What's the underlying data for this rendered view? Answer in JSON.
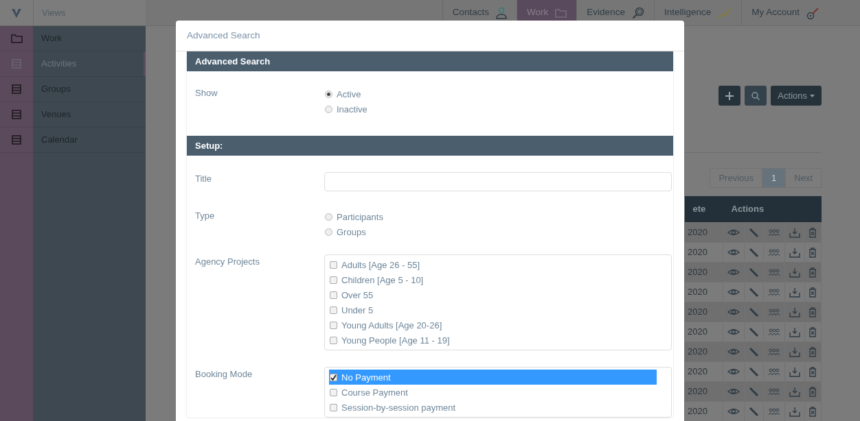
{
  "top_nav": {
    "section": "Views",
    "items": [
      {
        "label": "Contacts",
        "selected": false
      },
      {
        "label": "Work",
        "selected": true
      },
      {
        "label": "Evidence",
        "selected": false
      },
      {
        "label": "Intelligence",
        "selected": false
      },
      {
        "label": "My Account",
        "selected": false
      }
    ]
  },
  "sidebar": {
    "items": [
      {
        "label": "Work",
        "selected": false
      },
      {
        "label": "Activities",
        "selected": true
      },
      {
        "label": "Groups",
        "selected": false
      },
      {
        "label": "Venues",
        "selected": false
      },
      {
        "label": "Calendar",
        "selected": false
      }
    ]
  },
  "toolbar": {
    "actions_label": "Actions"
  },
  "pagination": {
    "previous": "Previous",
    "pages": [
      {
        "label": "1",
        "selected": true
      }
    ],
    "next": "Next"
  },
  "table": {
    "columns": [
      "ete",
      "Actions"
    ],
    "rows": [
      {
        "date": "2020"
      },
      {
        "date": "2020"
      },
      {
        "date": "2020"
      },
      {
        "date": "2020"
      },
      {
        "date": "2020"
      },
      {
        "date": "2020"
      },
      {
        "date": "2020"
      },
      {
        "date": "2020"
      },
      {
        "date": "2020"
      },
      {
        "date": "2020"
      }
    ]
  },
  "modal": {
    "title": "Advanced Search",
    "sections": [
      {
        "heading": "Advanced Search",
        "fields": [
          {
            "label": "Show",
            "kind": "radio",
            "options": [
              {
                "label": "Active",
                "selected": true
              },
              {
                "label": "Inactive",
                "selected": false
              }
            ]
          }
        ]
      },
      {
        "heading": "Setup:",
        "fields": [
          {
            "label": "Title",
            "kind": "text"
          },
          {
            "label": "Type",
            "kind": "radio",
            "options": [
              {
                "label": "Participants",
                "selected": false
              },
              {
                "label": "Groups",
                "selected": false
              }
            ]
          },
          {
            "label": "Agency Projects",
            "kind": "checklist",
            "options": [
              {
                "label": "Adults [Age 26 - 55]",
                "checked": false,
                "selected": false
              },
              {
                "label": "Children [Age 5 - 10]",
                "checked": false,
                "selected": false
              },
              {
                "label": "Over 55",
                "checked": false,
                "selected": false
              },
              {
                "label": "Under 5",
                "checked": false,
                "selected": false
              },
              {
                "label": "Young Adults [Age 20-26]",
                "checked": false,
                "selected": false
              },
              {
                "label": "Young People [Age 11 - 19]",
                "checked": false,
                "selected": false
              }
            ]
          },
          {
            "label": "Booking Mode",
            "kind": "checklist",
            "options": [
              {
                "label": "No Payment",
                "checked": true,
                "selected": true
              },
              {
                "label": "Course Payment",
                "checked": false,
                "selected": false
              },
              {
                "label": "Session-by-session payment",
                "checked": false,
                "selected": false
              }
            ]
          }
        ]
      }
    ]
  }
}
